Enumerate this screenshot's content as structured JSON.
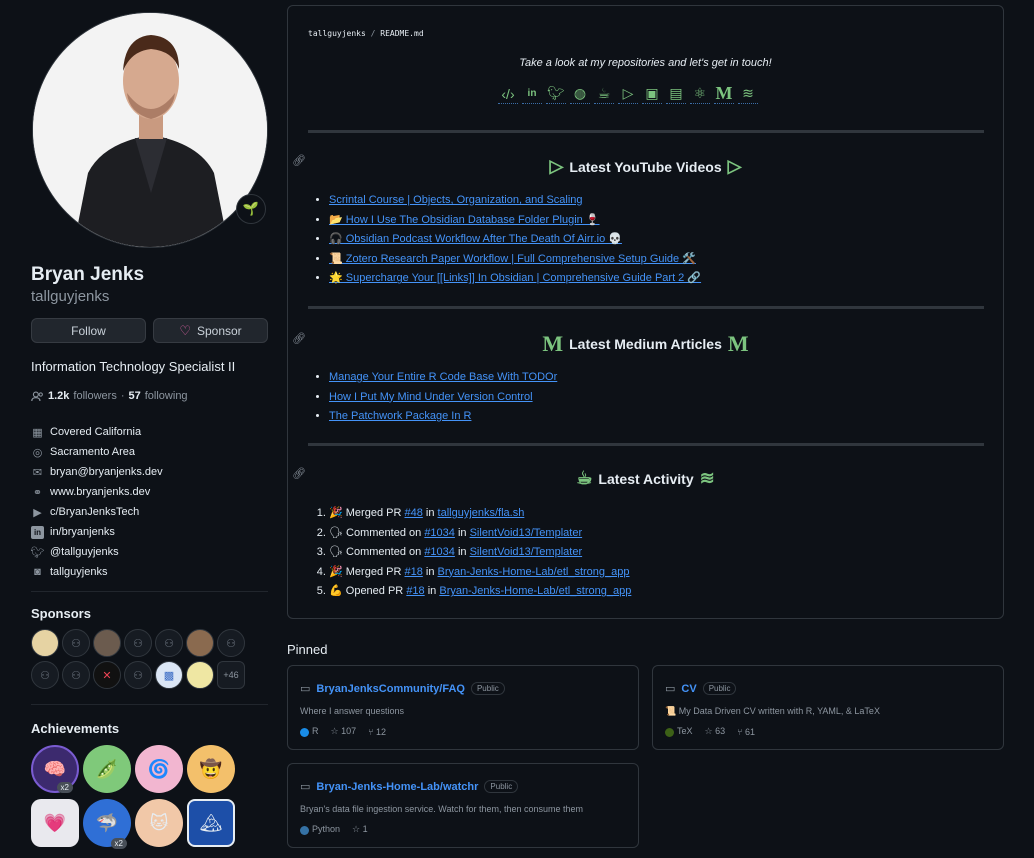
{
  "profile": {
    "full_name": "Bryan Jenks",
    "username": "tallguyjenks",
    "status_emoji": "🌱",
    "follow_label": "Follow",
    "sponsor_label": "Sponsor",
    "bio": "Information Technology Specialist II",
    "followers_count": "1.2k",
    "followers_label": "followers",
    "separator": "·",
    "following_count": "57",
    "following_label": "following",
    "details": [
      {
        "icon": "building-icon",
        "text": "Covered California"
      },
      {
        "icon": "location-icon",
        "text": "Sacramento Area"
      },
      {
        "icon": "mail-icon",
        "text": "bryan@bryanjenks.dev"
      },
      {
        "icon": "link-icon",
        "text": "www.bryanjenks.dev"
      },
      {
        "icon": "youtube-icon",
        "text": "c/BryanJenksTech"
      },
      {
        "icon": "linkedin-icon",
        "text": "in/bryanjenks"
      },
      {
        "icon": "twitter-icon",
        "text": "@tallguyjenks"
      },
      {
        "icon": "instagram-icon",
        "text": "tallguyjenks"
      }
    ]
  },
  "sponsors": {
    "title": "Sponsors",
    "more_label": "+46"
  },
  "achievements": {
    "title": "Achievements",
    "multiplier_1": "x2",
    "multiplier_2": "x2"
  },
  "readme": {
    "owner": "tallguyjenks",
    "separator": "/",
    "file": "README.md",
    "tagline": "Take a look at my repositories and let's get in touch!",
    "youtube_heading": "Latest YouTube Videos",
    "medium_heading": "Latest Medium Articles",
    "medium_glyph": "M",
    "activity_heading": "Latest Activity",
    "videos": [
      "Scrintal Course | Objects, Organization, and Scaling",
      "📂 How I Use The Obsidian Database Folder Plugin 🍷",
      "🎧 Obsidian Podcast Workflow After The Death Of Airr.io 💀",
      "📜 Zotero Research Paper Workflow | Full Comprehensive Setup Guide 🛠️",
      "🌟 Supercharge Your [[Links]] In Obsidian | Comprehensive Guide Part 2 🔗"
    ],
    "articles": [
      "Manage Your Entire R Code Base With TODOr",
      "How I Put My Mind Under Version Control",
      "The Patchwork Package In R"
    ],
    "activity": [
      {
        "emoji": "🎉",
        "action": "Merged PR",
        "ref": "#48",
        "in": "in",
        "repo": "tallguyjenks/fla.sh"
      },
      {
        "emoji": "🗣",
        "action": "Commented on",
        "ref": "#1034",
        "in": "in",
        "repo": "SilentVoid13/Templater"
      },
      {
        "emoji": "🗣",
        "action": "Commented on",
        "ref": "#1034",
        "in": "in",
        "repo": "SilentVoid13/Templater"
      },
      {
        "emoji": "🎉",
        "action": "Merged PR",
        "ref": "#18",
        "in": "in",
        "repo": "Bryan-Jenks-Home-Lab/etl_strong_app"
      },
      {
        "emoji": "💪",
        "action": "Opened PR",
        "ref": "#18",
        "in": "in",
        "repo": "Bryan-Jenks-Home-Lab/etl_strong_app"
      }
    ]
  },
  "pinned": {
    "title": "Pinned",
    "repos": [
      {
        "name": "BryanJenksCommunity/FAQ",
        "visibility": "Public",
        "description": "Where I answer questions",
        "language": "R",
        "lang_color": "#198ce7",
        "stars": "107",
        "forks": "12"
      },
      {
        "name": "CV",
        "visibility": "Public",
        "description": "📜 My Data Driven CV written with R, YAML, & LaTeX",
        "language": "TeX",
        "lang_color": "#3d6117",
        "stars": "63",
        "forks": "61"
      },
      {
        "name": "Bryan-Jenks-Home-Lab/watchr",
        "visibility": "Public",
        "description": "Bryan's data file ingestion service. Watch for them, then consume them",
        "language": "Python",
        "lang_color": "#3572A5",
        "stars": "1",
        "forks": ""
      }
    ]
  },
  "colors": {
    "background": "#0d1117",
    "link": "#4493f8",
    "accent_green": "#7cc47f",
    "muted": "#8d96a0"
  }
}
